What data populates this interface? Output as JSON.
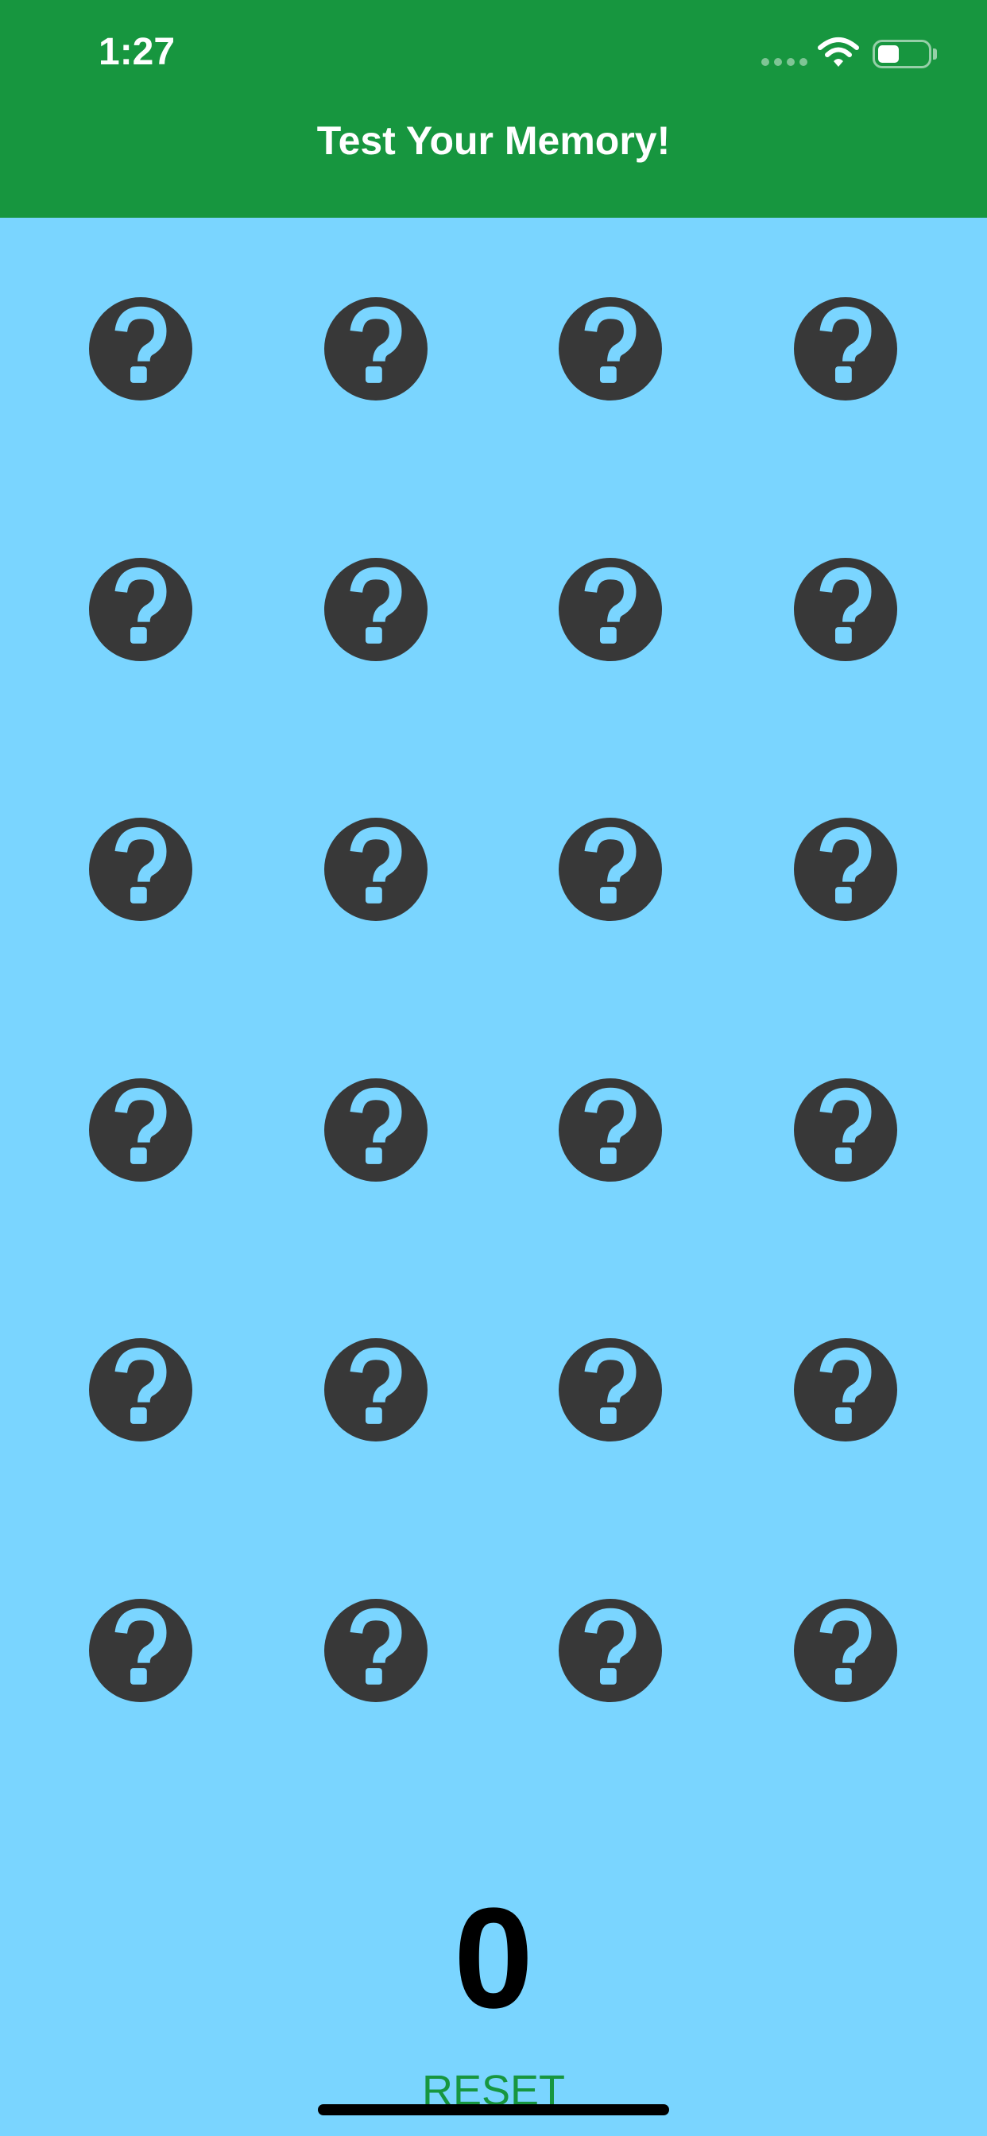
{
  "status_bar": {
    "time": "1:27",
    "signal_icon": "cellular-dots-icon",
    "wifi_icon": "wifi-icon",
    "battery_icon": "battery-icon"
  },
  "nav": {
    "title": "Test Your Memory!"
  },
  "grid": {
    "rows": 6,
    "columns": 4,
    "card_icon": "question-mark-circle-icon",
    "card_color": "#383838",
    "card_glyph_color": "#7AD5FF"
  },
  "score": {
    "value": "0"
  },
  "actions": {
    "reset_label": "RESET"
  },
  "colors": {
    "header": "#17963F",
    "background": "#7AD5FF",
    "accent": "#17963F"
  }
}
